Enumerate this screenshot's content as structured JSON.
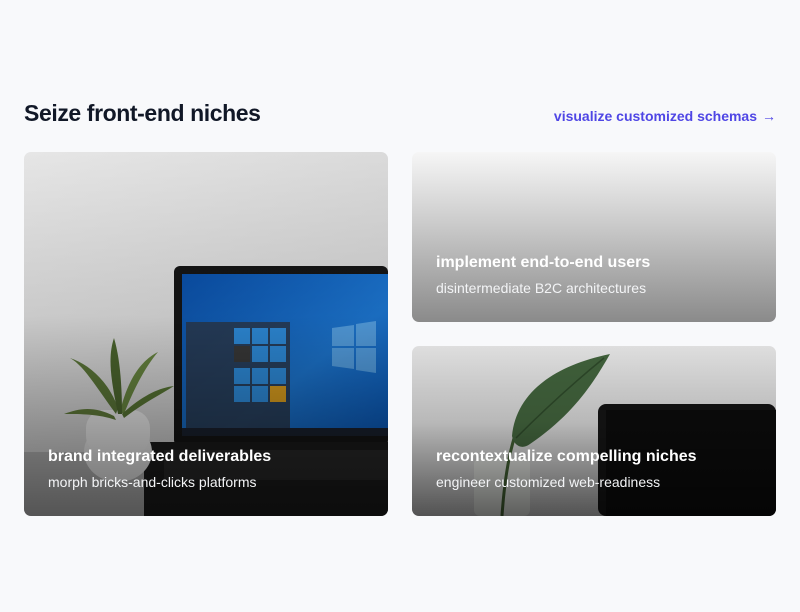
{
  "section": {
    "title": "Seize front-end niches",
    "link_label": "visualize customized schemas",
    "link_arrow": "→"
  },
  "cards": [
    {
      "title": "brand integrated deliverables",
      "subtitle": "morph bricks-and-clicks platforms",
      "image": "laptop-with-plant-photo"
    },
    {
      "title": "implement end-to-end users",
      "subtitle": "disintermediate B2C architectures",
      "image": "gray-gradient-photo"
    },
    {
      "title": "recontextualize compelling niches",
      "subtitle": "engineer customized web-readiness",
      "image": "leaf-and-tablet-photo"
    }
  ],
  "colors": {
    "background": "#f8f9fb",
    "title": "#111827",
    "accent": "#4f46e5",
    "card_text": "#ffffff"
  }
}
